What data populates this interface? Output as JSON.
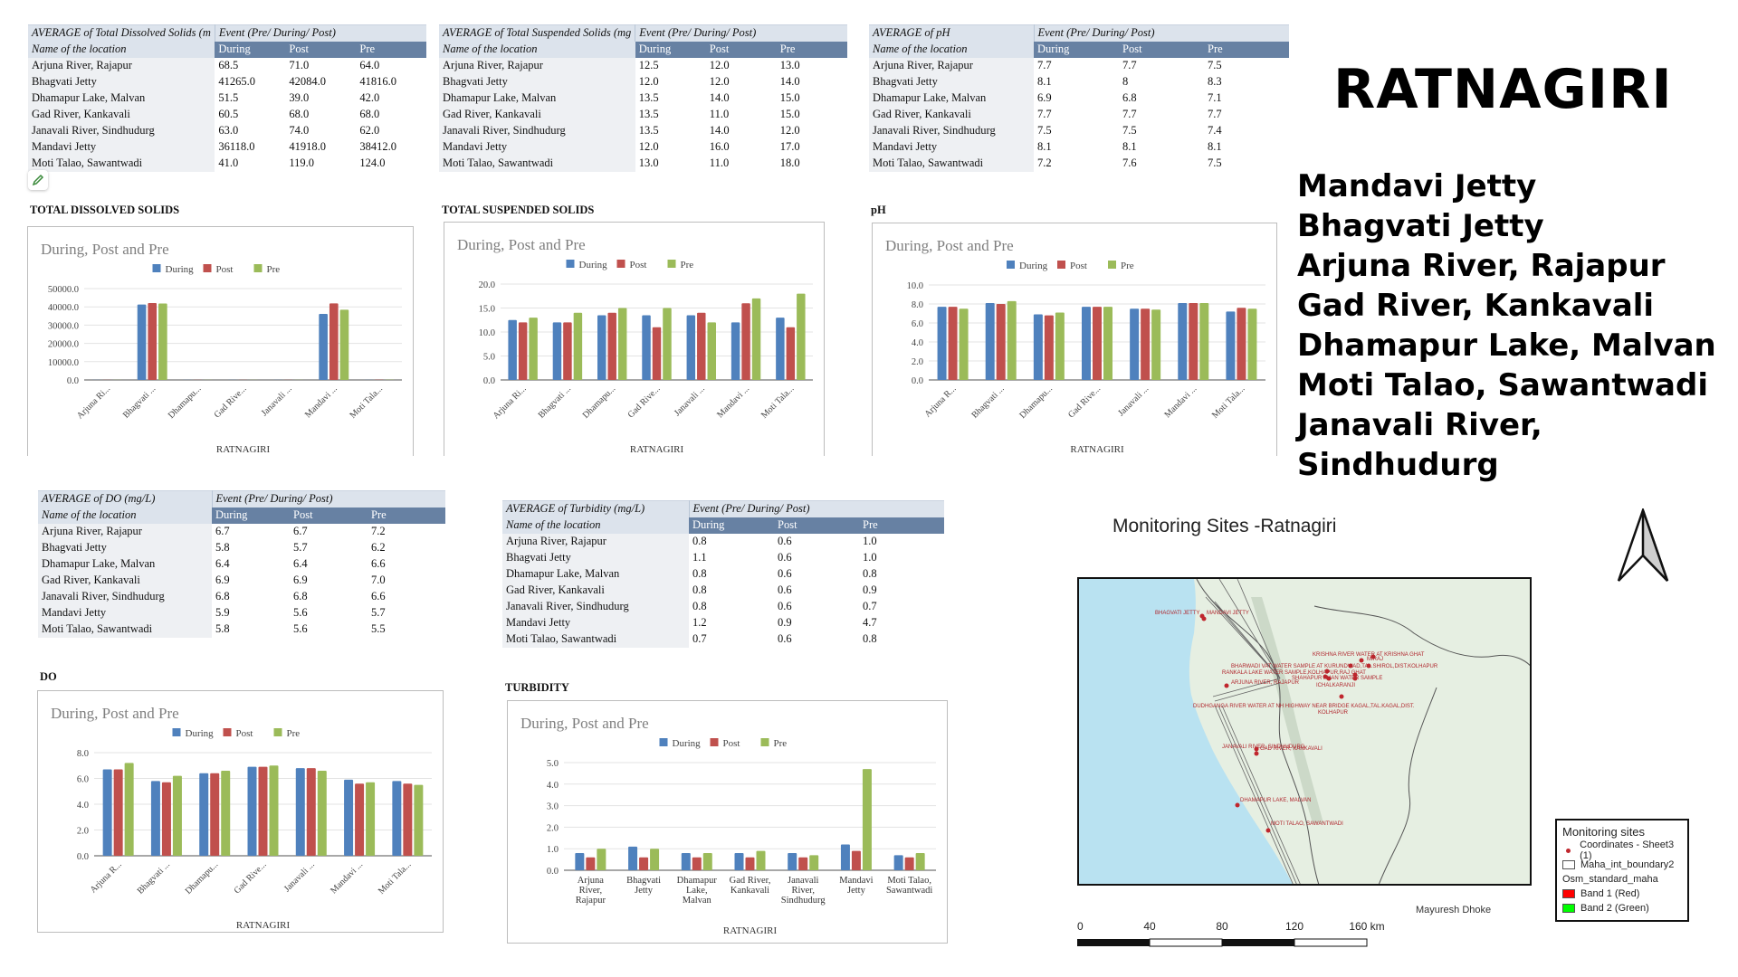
{
  "header": {
    "district_title": "RATNAGIRI",
    "site_list": [
      "Mandavi Jetty",
      "Bhagvati Jetty",
      "Arjuna River, Rajapur",
      "Gad River, Kankavali",
      "Dhamapur Lake, Malvan",
      "Moti Talao, Sawantwadi",
      "Janavali River, Sindhudurg"
    ]
  },
  "colors": {
    "during": "#4f81bd",
    "post": "#c0504d",
    "pre": "#9bbb59",
    "table_header": "#6781a3"
  },
  "tables": {
    "tds": {
      "title": "AVERAGE of Total Dissolved Solids (m",
      "event_header": "Event (Pre/ During/ Post)",
      "row_header": "Name of the location",
      "columns": [
        "During",
        "Post",
        "Pre"
      ],
      "rows": [
        {
          "loc": "Arjuna River, Rajapur",
          "v": [
            "68.5",
            "71.0",
            "64.0"
          ]
        },
        {
          "loc": "Bhagvati Jetty",
          "v": [
            "41265.0",
            "42084.0",
            "41816.0"
          ]
        },
        {
          "loc": "Dhamapur Lake, Malvan",
          "v": [
            "51.5",
            "39.0",
            "42.0"
          ]
        },
        {
          "loc": "Gad River, Kankavali",
          "v": [
            "60.5",
            "68.0",
            "68.0"
          ]
        },
        {
          "loc": "Janavali River, Sindhudurg",
          "v": [
            "63.0",
            "74.0",
            "62.0"
          ]
        },
        {
          "loc": "Mandavi Jetty",
          "v": [
            "36118.0",
            "41918.0",
            "38412.0"
          ]
        },
        {
          "loc": "Moti Talao, Sawantwadi",
          "v": [
            "41.0",
            "119.0",
            "124.0"
          ]
        }
      ]
    },
    "tss": {
      "title": "AVERAGE of Total Suspended Solids (mg",
      "event_header": "Event (Pre/ During/ Post)",
      "row_header": "Name of the location",
      "columns": [
        "During",
        "Post",
        "Pre"
      ],
      "rows": [
        {
          "loc": "Arjuna River, Rajapur",
          "v": [
            "12.5",
            "12.0",
            "13.0"
          ]
        },
        {
          "loc": "Bhagvati Jetty",
          "v": [
            "12.0",
            "12.0",
            "14.0"
          ]
        },
        {
          "loc": "Dhamapur Lake, Malvan",
          "v": [
            "13.5",
            "14.0",
            "15.0"
          ]
        },
        {
          "loc": "Gad River, Kankavali",
          "v": [
            "13.5",
            "11.0",
            "15.0"
          ]
        },
        {
          "loc": "Janavali River, Sindhudurg",
          "v": [
            "13.5",
            "14.0",
            "12.0"
          ]
        },
        {
          "loc": "Mandavi Jetty",
          "v": [
            "12.0",
            "16.0",
            "17.0"
          ]
        },
        {
          "loc": "Moti Talao, Sawantwadi",
          "v": [
            "13.0",
            "11.0",
            "18.0"
          ]
        }
      ]
    },
    "ph": {
      "title": "AVERAGE of pH",
      "event_header": "Event (Pre/ During/ Post)",
      "row_header": "Name of the location",
      "columns": [
        "During",
        "Post",
        "Pre"
      ],
      "rows": [
        {
          "loc": "Arjuna River, Rajapur",
          "v": [
            "7.7",
            "7.7",
            "7.5"
          ]
        },
        {
          "loc": "Bhagvati Jetty",
          "v": [
            "8.1",
            "8",
            "8.3"
          ]
        },
        {
          "loc": "Dhamapur Lake, Malvan",
          "v": [
            "6.9",
            "6.8",
            "7.1"
          ]
        },
        {
          "loc": "Gad River, Kankavali",
          "v": [
            "7.7",
            "7.7",
            "7.7"
          ]
        },
        {
          "loc": "Janavali River, Sindhudurg",
          "v": [
            "7.5",
            "7.5",
            "7.4"
          ]
        },
        {
          "loc": "Mandavi Jetty",
          "v": [
            "8.1",
            "8.1",
            "8.1"
          ]
        },
        {
          "loc": "Moti Talao, Sawantwadi",
          "v": [
            "7.2",
            "7.6",
            "7.5"
          ]
        }
      ]
    },
    "do": {
      "title": "AVERAGE of DO (mg/L)",
      "event_header": "Event (Pre/ During/ Post)",
      "row_header": "Name of the location",
      "columns": [
        "During",
        "Post",
        "Pre"
      ],
      "rows": [
        {
          "loc": "Arjuna River, Rajapur",
          "v": [
            "6.7",
            "6.7",
            "7.2"
          ]
        },
        {
          "loc": "Bhagvati Jetty",
          "v": [
            "5.8",
            "5.7",
            "6.2"
          ]
        },
        {
          "loc": "Dhamapur Lake, Malvan",
          "v": [
            "6.4",
            "6.4",
            "6.6"
          ]
        },
        {
          "loc": "Gad River, Kankavali",
          "v": [
            "6.9",
            "6.9",
            "7.0"
          ]
        },
        {
          "loc": "Janavali River, Sindhudurg",
          "v": [
            "6.8",
            "6.8",
            "6.6"
          ]
        },
        {
          "loc": "Mandavi Jetty",
          "v": [
            "5.9",
            "5.6",
            "5.7"
          ]
        },
        {
          "loc": "Moti Talao, Sawantwadi",
          "v": [
            "5.8",
            "5.6",
            "5.5"
          ]
        }
      ]
    },
    "turbidity": {
      "title": "AVERAGE of Turbidity (mg/L)",
      "event_header": "Event (Pre/ During/ Post)",
      "row_header": "Name of the location",
      "columns": [
        "During",
        "Post",
        "Pre"
      ],
      "rows": [
        {
          "loc": "Arjuna River, Rajapur",
          "v": [
            "0.8",
            "0.6",
            "1.0"
          ]
        },
        {
          "loc": "Bhagvati Jetty",
          "v": [
            "1.1",
            "0.6",
            "1.0"
          ]
        },
        {
          "loc": "Dhamapur Lake, Malvan",
          "v": [
            "0.8",
            "0.6",
            "0.8"
          ]
        },
        {
          "loc": "Gad River, Kankavali",
          "v": [
            "0.8",
            "0.6",
            "0.9"
          ]
        },
        {
          "loc": "Janavali River, Sindhudurg",
          "v": [
            "0.8",
            "0.6",
            "0.7"
          ]
        },
        {
          "loc": "Mandavi Jetty",
          "v": [
            "1.2",
            "0.9",
            "4.7"
          ]
        },
        {
          "loc": "Moti Talao, Sawantwadi",
          "v": [
            "0.7",
            "0.6",
            "0.8"
          ]
        }
      ]
    }
  },
  "chart_data": [
    {
      "id": "tds",
      "type": "bar",
      "section_title": "TOTAL DISSOLVED SOLIDS",
      "title": "During, Post and Pre",
      "xlabel": "RATNAGIRI",
      "ylabel": "",
      "categories": [
        "Arjuna Ri...",
        "Bhagvati ...",
        "Dhamapu...",
        "Gad Rive...",
        "Janavali ...",
        "Mandavi ...",
        "Moti Tala..."
      ],
      "label_style": "rotated",
      "ylim": [
        0,
        50000
      ],
      "yticks": [
        "0.0",
        "10000.0",
        "20000.0",
        "30000.0",
        "40000.0",
        "50000.0"
      ],
      "grid": true,
      "legend": "top-center",
      "series": [
        {
          "name": "During",
          "values": [
            68.5,
            41265.0,
            51.5,
            60.5,
            63.0,
            36118.0,
            41.0
          ]
        },
        {
          "name": "Post",
          "values": [
            71.0,
            42084.0,
            39.0,
            68.0,
            74.0,
            41918.0,
            119.0
          ]
        },
        {
          "name": "Pre",
          "values": [
            64.0,
            41816.0,
            42.0,
            68.0,
            62.0,
            38412.0,
            124.0
          ]
        }
      ]
    },
    {
      "id": "tss",
      "type": "bar",
      "section_title": "TOTAL SUSPENDED SOLIDS",
      "title": "During, Post and Pre",
      "xlabel": "RATNAGIRI",
      "ylabel": "",
      "categories": [
        "Arjuna Ri...",
        "Bhagvati ...",
        "Dhamapu...",
        "Gad Rive...",
        "Janavali ...",
        "Mandavi ...",
        "Moti Tala..."
      ],
      "label_style": "rotated",
      "ylim": [
        0,
        20
      ],
      "yticks": [
        "0.0",
        "5.0",
        "10.0",
        "15.0",
        "20.0"
      ],
      "grid": true,
      "legend": "top-center",
      "series": [
        {
          "name": "During",
          "values": [
            12.5,
            12.0,
            13.5,
            13.5,
            13.5,
            12.0,
            13.0
          ]
        },
        {
          "name": "Post",
          "values": [
            12.0,
            12.0,
            14.0,
            11.0,
            14.0,
            16.0,
            11.0
          ]
        },
        {
          "name": "Pre",
          "values": [
            13.0,
            14.0,
            15.0,
            15.0,
            12.0,
            17.0,
            18.0
          ]
        }
      ]
    },
    {
      "id": "ph",
      "type": "bar",
      "section_title": "pH",
      "title": "During, Post and Pre",
      "xlabel": "RATNAGIRI",
      "ylabel": "",
      "categories": [
        "Arjuna R...",
        "Bhagvati ...",
        "Dhamapu...",
        "Gad Rive...",
        "Janavali ...",
        "Mandavi ...",
        "Moti Tala..."
      ],
      "label_style": "rotated",
      "ylim": [
        0,
        10
      ],
      "yticks": [
        "0.0",
        "2.0",
        "4.0",
        "6.0",
        "8.0",
        "10.0"
      ],
      "grid": true,
      "legend": "top-center",
      "series": [
        {
          "name": "During",
          "values": [
            7.7,
            8.1,
            6.9,
            7.7,
            7.5,
            8.1,
            7.2
          ]
        },
        {
          "name": "Post",
          "values": [
            7.7,
            8.0,
            6.8,
            7.7,
            7.5,
            8.1,
            7.6
          ]
        },
        {
          "name": "Pre",
          "values": [
            7.5,
            8.3,
            7.1,
            7.7,
            7.4,
            8.1,
            7.5
          ]
        }
      ]
    },
    {
      "id": "do",
      "type": "bar",
      "section_title": "DO",
      "title": "During, Post and Pre",
      "xlabel": "RATNAGIRI",
      "ylabel": "",
      "categories": [
        "Arjuna R...",
        "Bhagvati ...",
        "Dhamapu...",
        "Gad Rive...",
        "Janavali ...",
        "Mandavi ...",
        "Moti Tala..."
      ],
      "label_style": "rotated",
      "ylim": [
        0,
        8
      ],
      "yticks": [
        "0.0",
        "2.0",
        "4.0",
        "6.0",
        "8.0"
      ],
      "grid": true,
      "legend": "top-center",
      "series": [
        {
          "name": "During",
          "values": [
            6.7,
            5.8,
            6.4,
            6.9,
            6.8,
            5.9,
            5.8
          ]
        },
        {
          "name": "Post",
          "values": [
            6.7,
            5.7,
            6.4,
            6.9,
            6.8,
            5.6,
            5.6
          ]
        },
        {
          "name": "Pre",
          "values": [
            7.2,
            6.2,
            6.6,
            7.0,
            6.6,
            5.7,
            5.5
          ]
        }
      ]
    },
    {
      "id": "turbidity",
      "type": "bar",
      "section_title": "TURBIDITY",
      "title": "During, Post and Pre",
      "xlabel": "RATNAGIRI",
      "ylabel": "",
      "categories": [
        "Arjuna River, Rajapur",
        "Bhagvati Jetty",
        "Dhamapur Lake, Malvan",
        "Gad River, Kankavali",
        "Janavali River, Sindhudurg",
        "Mandavi Jetty",
        "Moti Talao, Sawantwadi"
      ],
      "category_lines": [
        [
          "Arjuna",
          "River,",
          "Rajapur"
        ],
        [
          "Bhagvati",
          "Jetty"
        ],
        [
          "Dhamapur",
          "Lake,",
          "Malvan"
        ],
        [
          "Gad River,",
          "Kankavali"
        ],
        [
          "Janavali",
          "River,",
          "Sindhudurg"
        ],
        [
          "Mandavi",
          "Jetty"
        ],
        [
          "Moti Talao,",
          "Sawantwadi"
        ]
      ],
      "label_style": "wrapped",
      "ylim": [
        0,
        5
      ],
      "yticks": [
        "0.0",
        "1.0",
        "2.0",
        "3.0",
        "4.0",
        "5.0"
      ],
      "grid": true,
      "legend": "top-center",
      "series": [
        {
          "name": "During",
          "values": [
            0.8,
            1.1,
            0.8,
            0.8,
            0.8,
            1.2,
            0.7
          ]
        },
        {
          "name": "Post",
          "values": [
            0.6,
            0.6,
            0.6,
            0.6,
            0.6,
            0.9,
            0.6
          ]
        },
        {
          "name": "Pre",
          "values": [
            1.0,
            1.0,
            0.8,
            0.9,
            0.7,
            4.7,
            0.8
          ]
        }
      ]
    }
  ],
  "map": {
    "title": "Monitoring Sites -Ratnagiri",
    "author": "Mayuresh Dhoke",
    "site_labels": [
      "BHAGVATI JETTY",
      "MANDAVI JETTY",
      "KRISHNA RIVER WATER AT KRISHNA GHAT",
      "MIRAJ",
      "BHARWADI VAT WATER SAMPLE AT KURUNDWAD,TAL.SHIROL,DIST.KOLHAPUR",
      "RANKALA LAKE WATER SAMPLE,KOLHAPUR,RAJ GHAT",
      "SHAHAPUR KHAN WATER SAMPLE",
      "ICHALKARANJI",
      "ARJUNA RIVER, RAJAPUR",
      "DUDHGANGA RIVER WATER AT NH HIGHWAY NEAR BRIDGE KAGAL,TAL.KAGAL,DIST.",
      "KOLHAPUR",
      "JANAVALI RIVER, SINDHUDURG",
      "GAD RIVER, KANKAVALI",
      "DHAMAPUR LAKE, MALVAN",
      "MOTI TALAO, SAWANTWADI"
    ],
    "legend": {
      "title": "Monitoring sites",
      "items": [
        {
          "label": "Coordinates - Sheet3 (1)",
          "kind": "point",
          "color": "#c0262d"
        },
        {
          "label": "Maha_int_boundary2",
          "kind": "outline",
          "color": "#ffffff"
        },
        {
          "label": "Osm_standard_maha",
          "kind": "heading"
        },
        {
          "label": "Band 1 (Red)",
          "kind": "fill",
          "color": "#ff0000"
        },
        {
          "label": "Band 2 (Green)",
          "kind": "fill",
          "color": "#00ff00"
        }
      ]
    },
    "scale": {
      "ticks": [
        "0",
        "40",
        "80",
        "120",
        "160 km"
      ]
    }
  }
}
